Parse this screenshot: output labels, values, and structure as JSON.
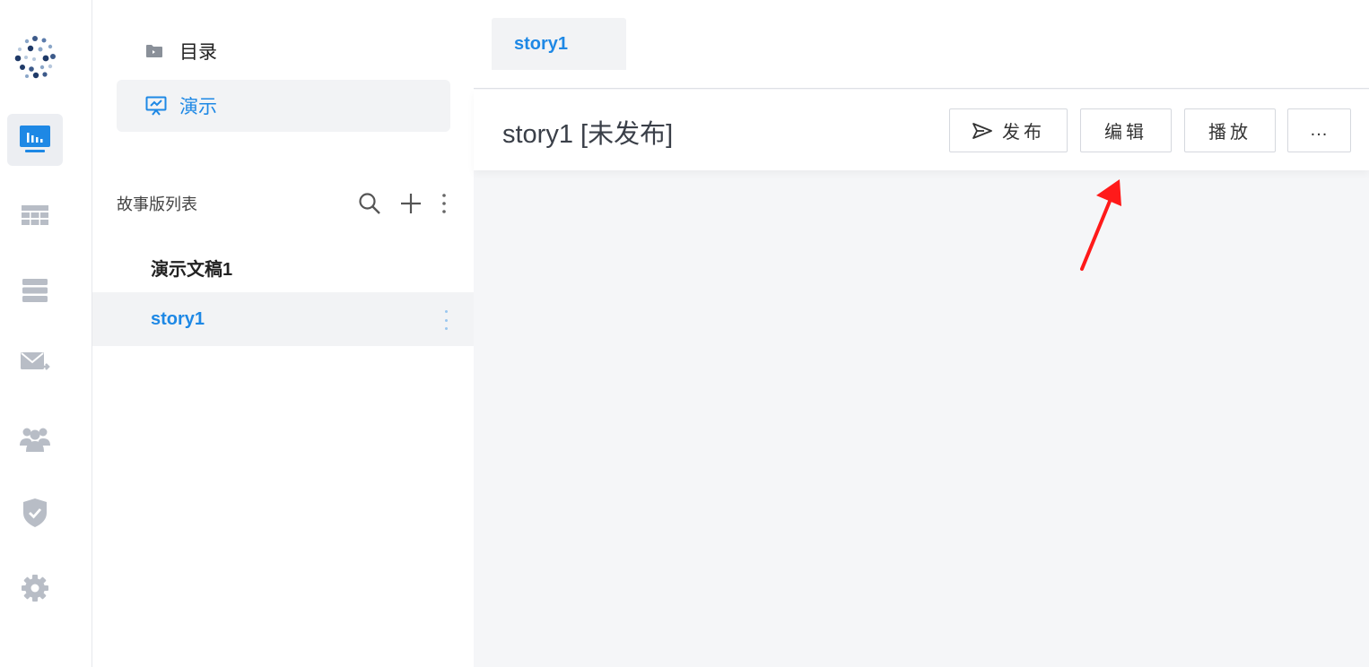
{
  "colors": {
    "accent": "#1e88e5",
    "annotation_arrow": "#ff1a1a"
  },
  "rail": {
    "logo_icon": "brand-logo",
    "items": [
      {
        "icon": "presentation-monitor-icon",
        "active": true
      },
      {
        "icon": "table-grid-icon",
        "active": false
      },
      {
        "icon": "stacked-layers-icon",
        "active": false
      },
      {
        "icon": "mail-forward-icon",
        "active": false
      },
      {
        "icon": "users-group-icon",
        "active": false
      },
      {
        "icon": "shield-check-icon",
        "active": false
      },
      {
        "icon": "gear-icon",
        "active": false
      }
    ]
  },
  "sidebar": {
    "nav": [
      {
        "label": "目录",
        "icon": "folder-icon",
        "active": false
      },
      {
        "label": "演示",
        "icon": "presentation-icon",
        "active": true
      }
    ],
    "list_title": "故事版列表",
    "tools": [
      "search-icon",
      "plus-icon",
      "more-vertical-icon"
    ],
    "items": [
      {
        "label": "演示文稿1",
        "active": false
      },
      {
        "label": "story1",
        "active": true
      }
    ]
  },
  "main": {
    "tab_label": "story1",
    "doc_title": "story1 [未发布]",
    "buttons": {
      "publish": "发布",
      "edit": "编辑",
      "play": "播放",
      "more": "..."
    }
  }
}
